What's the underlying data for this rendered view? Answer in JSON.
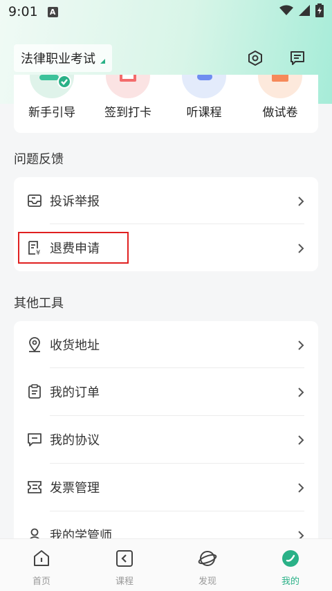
{
  "status": {
    "time": "9:01",
    "badge": "A"
  },
  "header": {
    "exam_title": "法律职业考试"
  },
  "quick_actions": [
    {
      "label": "新手引导",
      "icon": "guide-icon",
      "color": "#dff3ea"
    },
    {
      "label": "签到打卡",
      "icon": "checkin-icon",
      "color": "#fbe3e3"
    },
    {
      "label": "听课程",
      "icon": "course-audio-icon",
      "color": "#e3ebfb"
    },
    {
      "label": "做试卷",
      "icon": "exam-paper-icon",
      "color": "#fde9dc"
    }
  ],
  "feedback": {
    "title": "问题反馈",
    "items": [
      {
        "label": "投诉举报"
      },
      {
        "label": "退费申请"
      }
    ]
  },
  "tools": {
    "title": "其他工具",
    "items": [
      {
        "label": "收货地址"
      },
      {
        "label": "我的订单"
      },
      {
        "label": "我的协议"
      },
      {
        "label": "发票管理"
      },
      {
        "label": "我的学管师"
      }
    ]
  },
  "tabbar": {
    "items": [
      {
        "label": "首页"
      },
      {
        "label": "课程"
      },
      {
        "label": "发现"
      },
      {
        "label": "我的"
      }
    ],
    "active_color": "#2ab187"
  }
}
